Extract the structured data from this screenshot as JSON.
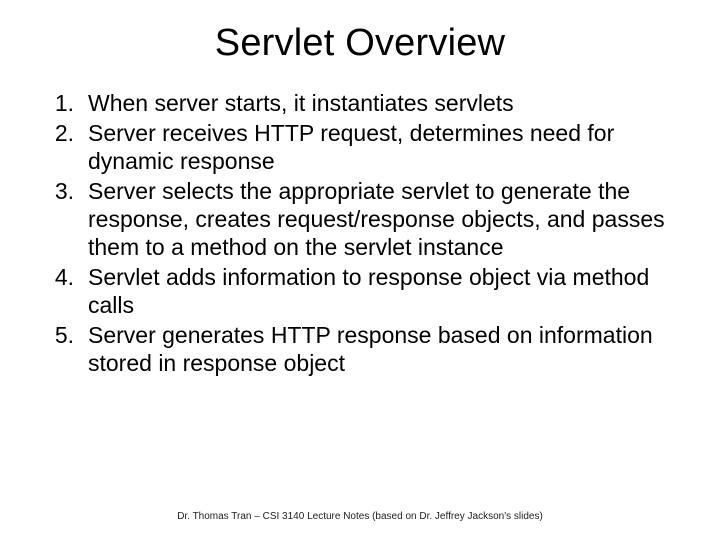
{
  "title": "Servlet Overview",
  "items": [
    {
      "n": "1.",
      "t": "When server starts, it instantiates servlets"
    },
    {
      "n": "2.",
      "t": "Server receives HTTP request, determines need for dynamic response"
    },
    {
      "n": "3.",
      "t": "Server selects the appropriate servlet to generate the response, creates request/response objects, and passes them to a method on the servlet instance"
    },
    {
      "n": "4.",
      "t": "Servlet adds information to response object via method calls"
    },
    {
      "n": "5.",
      "t": "Server generates HTTP response based on information stored in response object"
    }
  ],
  "footer": "Dr. Thomas Tran – CSI 3140 Lecture Notes (based on Dr. Jeffrey Jackson's slides)"
}
